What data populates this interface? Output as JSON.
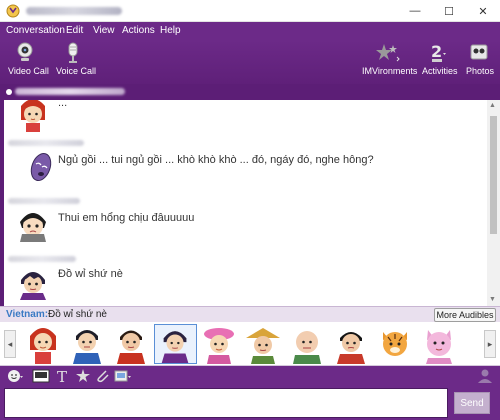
{
  "window": {
    "controls": {
      "minimize": "—",
      "maximize": "☐",
      "close": "✕"
    }
  },
  "menu": {
    "items": [
      "Conversation",
      "Edit",
      "View",
      "Actions",
      "Help"
    ]
  },
  "toolbar": {
    "video_call": "Video Call",
    "voice_call": "Voice Call",
    "imvironments": "IMVironments",
    "activities": "Activities",
    "photos": "Photos"
  },
  "messages": [
    {
      "text": "...",
      "avatar": "girl-red-hair"
    },
    {
      "text": "Ngủ gồi ... tui ngủ gồi ... khò khò khò ... đó, ngáy đó, nghe hông?",
      "avatar": "purple-sleeping"
    },
    {
      "text": "Thui em hổng chịu đâuuuuu",
      "avatar": "girl-sad"
    },
    {
      "text": "Đồ wỉ shứ nè",
      "avatar": "boy-purple"
    }
  ],
  "audibles": {
    "language": "Vietnam:",
    "current": "Đồ wỉ shứ nè",
    "more_button": "More Audibles",
    "prev": "◂",
    "next": "▸",
    "items": [
      "girl-red-hair",
      "boy-blue-shirt",
      "boy-red-shirt",
      "boy-purple",
      "girl-pink-hat",
      "man-straw-hat",
      "man-bald",
      "man-black-hair",
      "tiger",
      "pink-cat"
    ]
  },
  "send": {
    "label": "Send"
  },
  "colors": {
    "chrome": "#6c2a88",
    "dark_chrome": "#5c1e76",
    "accent_blue": "#3a7ac4"
  }
}
